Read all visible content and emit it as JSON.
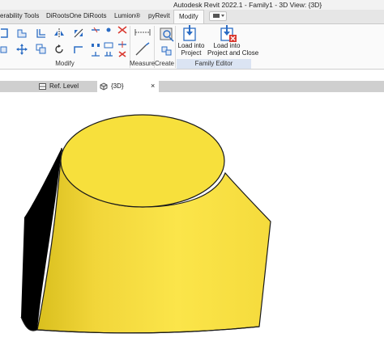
{
  "window": {
    "title": "Autodesk Revit 2022.1 - Family1 - 3D View: {3D}"
  },
  "ribbon_tabs": [
    {
      "label": "erability Tools"
    },
    {
      "label": "DiRootsOne"
    },
    {
      "label": "DiRoots"
    },
    {
      "label": "Lumion®"
    },
    {
      "label": "pyRevit"
    },
    {
      "label": "Modify"
    }
  ],
  "active_tab": "Modify",
  "panels": {
    "modify": {
      "label": "Modify"
    },
    "measure": {
      "label": "Measure"
    },
    "create": {
      "label": "Create"
    },
    "family_editor": {
      "label": "Family Editor",
      "load_into_project": {
        "line1": "Load into",
        "line2": "Project"
      },
      "load_into_project_close": {
        "line1": "Load into",
        "line2": "Project and Close"
      }
    }
  },
  "view_tabs": [
    {
      "label": "Ref. Level",
      "icon": "floor-plan-icon",
      "active": false,
      "closable": false
    },
    {
      "label": "{3D}",
      "icon": "3d-view-icon",
      "active": true,
      "closable": true,
      "close_glyph": "×"
    }
  ],
  "model": {
    "shape": "frustum-round-top-square-base",
    "fill_color": "#f7e03c",
    "shade_color": "#000000",
    "edge_color": "#1a1a1a"
  },
  "colors": {
    "ribbon_bg": "#fafafa",
    "tabs_bg": "#e6e6e6",
    "family_editor_bar": "#dbe4f3",
    "view_tab_strip": "#cfcfcf",
    "accent_blue": "#2b6cc4",
    "accent_red": "#d9382f"
  }
}
